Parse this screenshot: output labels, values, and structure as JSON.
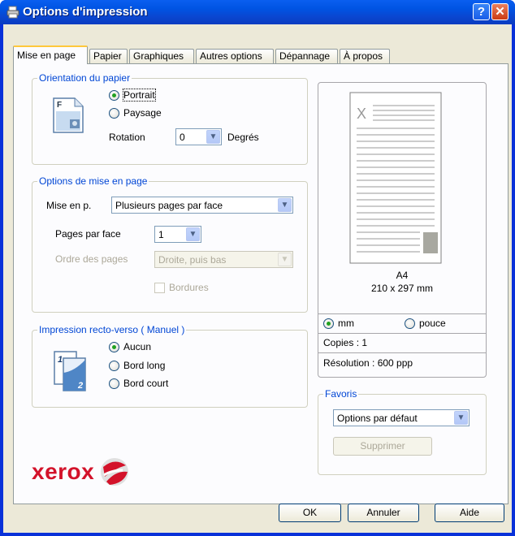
{
  "window": {
    "title": "Options d'impression"
  },
  "tabs": [
    {
      "label": "Mise en page"
    },
    {
      "label": "Papier"
    },
    {
      "label": "Graphiques"
    },
    {
      "label": "Autres options"
    },
    {
      "label": "Dépannage"
    },
    {
      "label": "À propos"
    }
  ],
  "orientation": {
    "legend": "Orientation du papier",
    "portrait": "Portrait",
    "paysage": "Paysage",
    "rotation_label": "Rotation",
    "rotation_value": "0",
    "rotation_unit": "Degrés",
    "selected": "portrait"
  },
  "layout": {
    "legend": "Options de mise en page",
    "mise_en_p_label": "Mise en p.",
    "mise_en_p_value": "Plusieurs pages par face",
    "pages_par_face_label": "Pages par face",
    "pages_par_face_value": "1",
    "ordre_label": "Ordre des pages",
    "ordre_value": "Droite, puis bas",
    "bordures_label": "Bordures"
  },
  "duplex": {
    "legend": "Impression recto-verso ( Manuel )",
    "aucun": "Aucun",
    "bord_long": "Bord long",
    "bord_court": "Bord court",
    "selected": "aucun"
  },
  "brand": {
    "logo": "xerox"
  },
  "preview": {
    "paper": "A4",
    "size": "210 x 297 mm",
    "unit_mm": "mm",
    "unit_pouce": "pouce",
    "selected_unit": "mm",
    "copies": "Copies : 1",
    "resolution": "Résolution : 600 ppp"
  },
  "favoris": {
    "legend": "Favoris",
    "value": "Options par défaut",
    "delete_label": "Supprimer"
  },
  "footer": {
    "ok": "OK",
    "cancel": "Annuler",
    "help": "Aide"
  }
}
